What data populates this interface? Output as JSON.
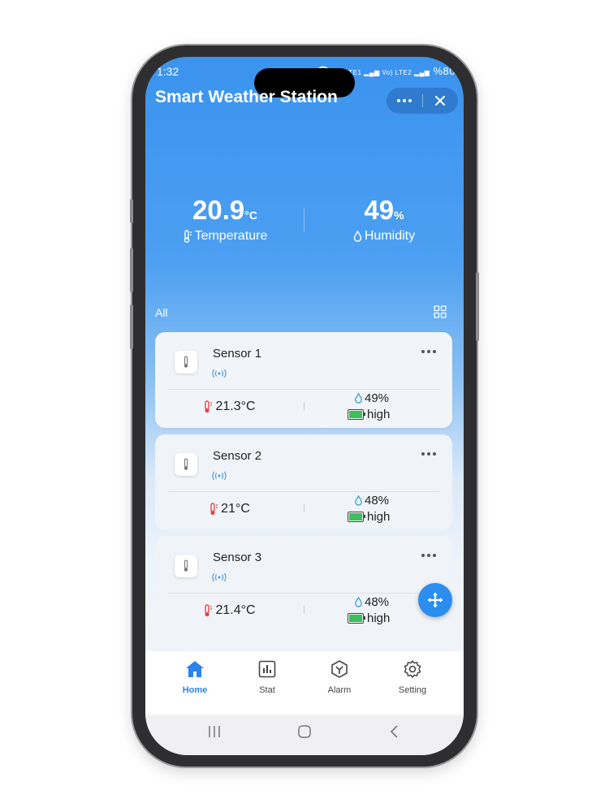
{
  "status_bar": {
    "time": "1:32",
    "indicators": "Vo) LTE1 Vo) LTE2 %80",
    "battery_text": "%80"
  },
  "app": {
    "title": "Smart Weather Station",
    "menu_icon": "more-dots-icon",
    "close_icon": "close-icon"
  },
  "summary": {
    "temperature": {
      "value": "20.9",
      "unit": "°C",
      "label": "Temperature",
      "icon": "thermometer-icon"
    },
    "humidity": {
      "value": "49",
      "unit": "%",
      "label": "Humidity",
      "icon": "droplet-icon"
    }
  },
  "list": {
    "label": "All",
    "view_icon": "grid-icon"
  },
  "sensors": [
    {
      "name": "Sensor 1",
      "temperature": "21.3°C",
      "humidity": "49%",
      "battery": "high"
    },
    {
      "name": "Sensor 2",
      "temperature": "21°C",
      "humidity": "48%",
      "battery": "high"
    },
    {
      "name": "Sensor 3",
      "temperature": "21.4°C",
      "humidity": "48%",
      "battery": "high"
    }
  ],
  "tabs": [
    {
      "label": "Home",
      "icon": "home-icon",
      "active": true
    },
    {
      "label": "Stat",
      "icon": "chart-icon",
      "active": false
    },
    {
      "label": "Alarm",
      "icon": "alarm-icon",
      "active": false
    },
    {
      "label": "Setting",
      "icon": "gear-icon",
      "active": false
    }
  ],
  "colors": {
    "accent": "#2a85e8",
    "header_blue": "#3b93ee",
    "temp_red": "#e04848",
    "humidity_blue": "#3aa0d8",
    "battery_green": "#3cc05a"
  }
}
